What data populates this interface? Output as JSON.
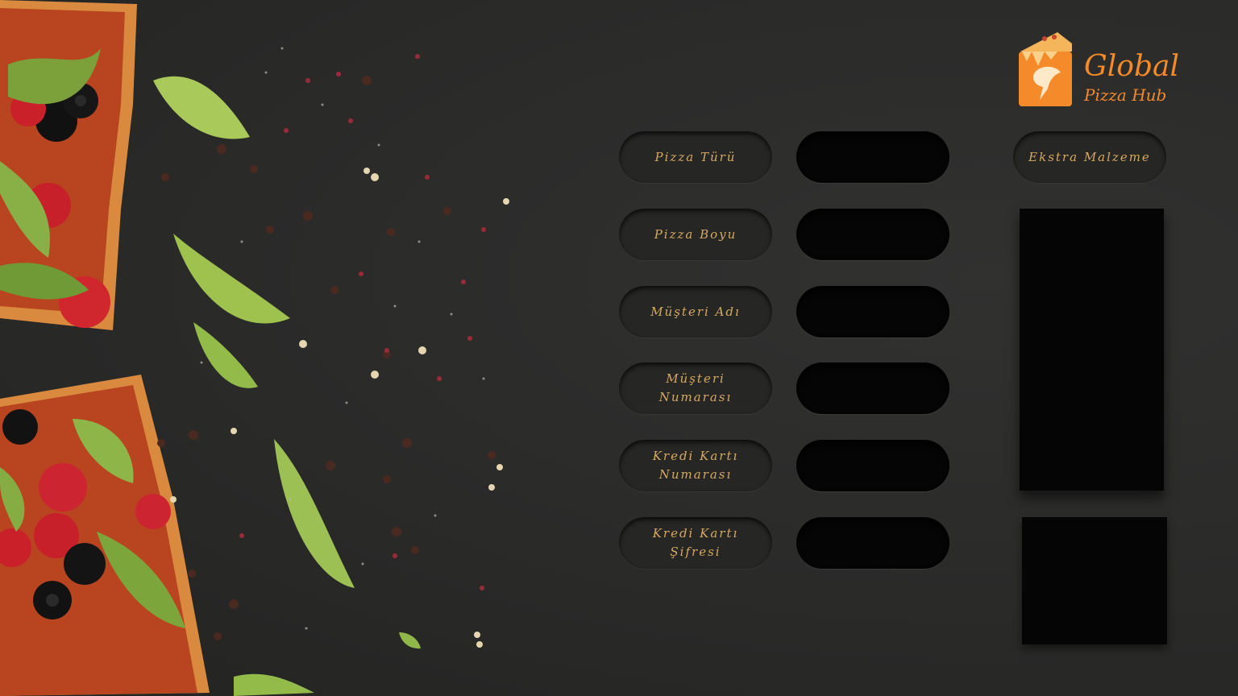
{
  "brand": {
    "line1": "Global",
    "line2": "Pizza Hub",
    "accent": "#f58a2a"
  },
  "form": {
    "labels": [
      "Pizza Türü",
      "Pizza Boyu",
      "Müşteri Adı",
      "Müşteri Numarası",
      "Kredi Kartı Numarası",
      "Kredi Kartı Şifresi"
    ],
    "fields": [
      "",
      "",
      "",
      "",
      "",
      ""
    ],
    "label_color": "#d7a960"
  },
  "extras": {
    "label": "Ekstra Malzeme",
    "items": []
  }
}
